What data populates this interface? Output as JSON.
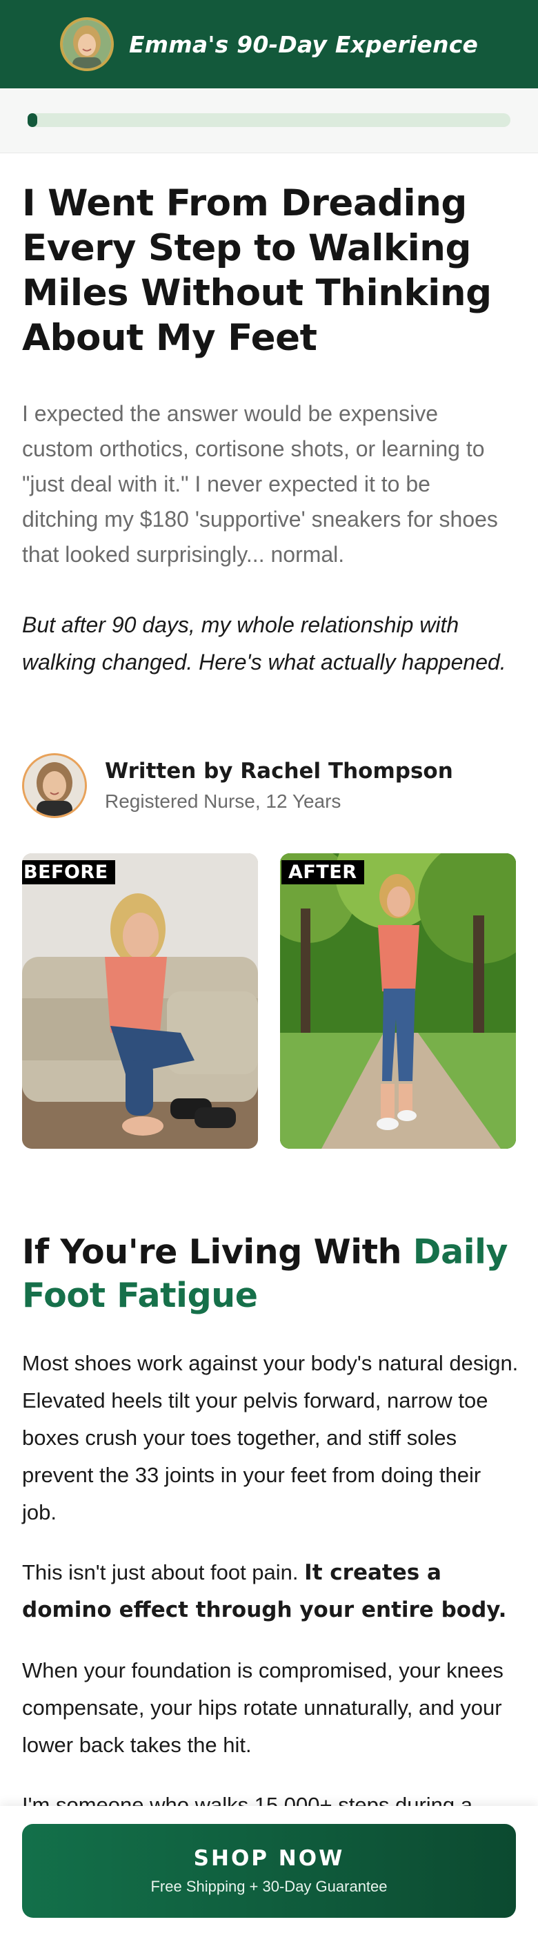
{
  "header": {
    "title": "Emma's 90-Day Experience",
    "avatar_icon": "woman-portrait",
    "bg_color": "#13593b"
  },
  "progress": {
    "fraction": 0.02
  },
  "headline": "I Went From Dreading Every Step to Walking Miles Without Thinking About My Feet",
  "lead": "I expected the answer would be expensive custom orthotics, cortisone shots, or learning to \"just deal with it.\" I never expected it to be ditching my $180 'supportive' sneakers for shoes that looked surprisingly... normal.",
  "lead_italic": "But after 90 days, my whole relationship with walking changed. Here's what actually happened.",
  "author": {
    "name": "Written by Rachel Thompson",
    "role": "Registered Nurse, 12 Years"
  },
  "photos": {
    "before_label": "BEFORE",
    "after_label": "AFTER"
  },
  "section": {
    "title_plain": "If You're Living With ",
    "title_highlight": "Daily Foot Fatigue",
    "accent_color": "#16704a"
  },
  "paragraphs": {
    "p1": "Most shoes work against your body's natural design. Elevated heels tilt your pelvis forward, narrow toe boxes crush your toes together, and stiff soles prevent the 33 joints in your feet from doing their job.",
    "p2_plain": "This isn't just about foot pain. ",
    "p2_bold": "It creates a domino effect through your entire body.",
    "p3": "When your foundation is compromised, your knees compensate, your hips rotate unnaturally, and your lower back takes the hit.",
    "p4": "I'm someone who walks 15,000+ steps during a"
  },
  "cta": {
    "label": "SHOP NOW",
    "sublabel": "Free Shipping + 30-Day Guarantee"
  }
}
